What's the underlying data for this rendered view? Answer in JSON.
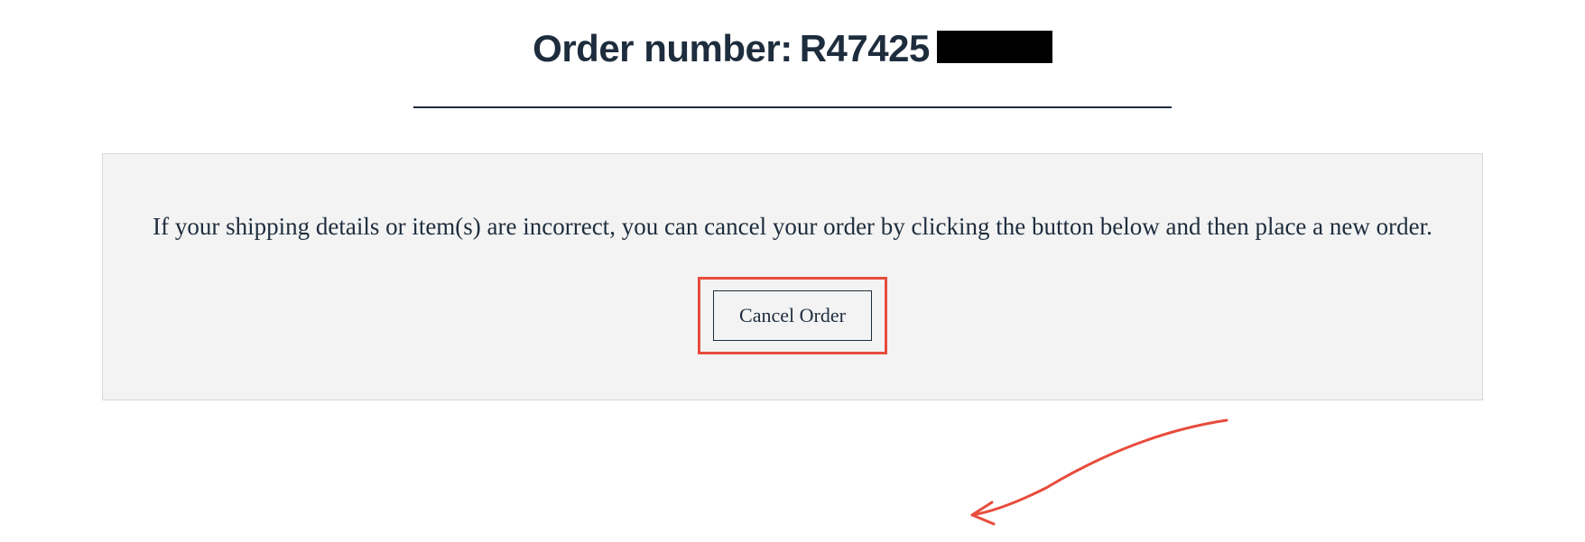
{
  "header": {
    "order_label": "Order number:",
    "order_number_visible": "R47425"
  },
  "info_box": {
    "message": "If your shipping details or item(s) are incorrect, you can cancel your order by clicking the button below and then place a new order.",
    "cancel_button_label": "Cancel Order"
  },
  "annotation": {
    "highlight_color": "#e74c3c"
  }
}
